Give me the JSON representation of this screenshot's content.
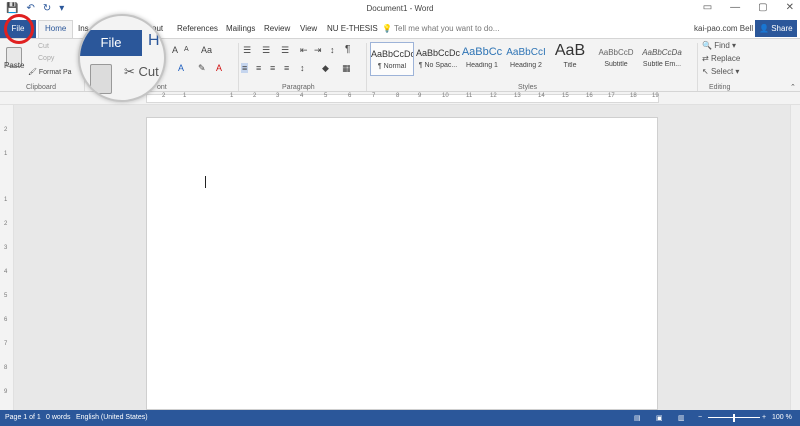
{
  "window": {
    "title": "Document1 - Word",
    "qat": {
      "save": "💾",
      "undo": "↶",
      "redo": "↻",
      "customize": "▾"
    },
    "controls": {
      "ribbon_options": "▭",
      "minimize": "—",
      "maximize": "▢",
      "close": "✕"
    }
  },
  "tabs": {
    "file": "File",
    "home": "Home",
    "insert": "Ins",
    "layout": "out",
    "references": "References",
    "mailings": "Mailings",
    "review": "Review",
    "view": "View",
    "nu": "NU E-THESIS",
    "tell_me": "Tell me what you want to do...",
    "account": "kai-pao.com Bell",
    "share": "Share"
  },
  "ribbon": {
    "clipboard": {
      "label": "Clipboard",
      "paste": "Paste",
      "cut": "Cut",
      "copy": "Copy",
      "format_painter": "Format Pa"
    },
    "font": {
      "label": "ont",
      "grow": "A",
      "shrink": "A",
      "case": "Aa"
    },
    "paragraph": {
      "label": "Paragraph",
      "pilcrow": "¶"
    },
    "styles": {
      "label": "Styles",
      "items": [
        {
          "sample": "AaBbCcDc",
          "name": "¶ Normal"
        },
        {
          "sample": "AaBbCcDc",
          "name": "¶ No Spac..."
        },
        {
          "sample": "AaBbCc",
          "name": "Heading 1"
        },
        {
          "sample": "AaBbCcI",
          "name": "Heading 2"
        },
        {
          "sample": "AaB",
          "name": "Title"
        },
        {
          "sample": "AaBbCcD",
          "name": "Subtitle"
        },
        {
          "sample": "AaBbCcDa",
          "name": "Subtle Em..."
        }
      ]
    },
    "editing": {
      "label": "Editing",
      "find": "Find",
      "replace": "Replace",
      "select": "Select"
    }
  },
  "ruler": {
    "numbers": [
      "2",
      "1",
      "1",
      "2",
      "3",
      "4",
      "5",
      "6",
      "7",
      "8",
      "9",
      "10",
      "11",
      "12",
      "13",
      "14",
      "15",
      "16",
      "17",
      "18",
      "19"
    ],
    "vertical": [
      "2",
      "1",
      "1",
      "2",
      "3",
      "4",
      "5",
      "6",
      "7",
      "8",
      "9"
    ]
  },
  "magnifier": {
    "file": "File",
    "cut": "Cut",
    "heading": "H"
  },
  "status": {
    "page": "Page 1 of 1",
    "words": "0 words",
    "language": "English (United States)",
    "zoom_minus": "−",
    "zoom_plus": "+",
    "zoom": "100 %"
  }
}
